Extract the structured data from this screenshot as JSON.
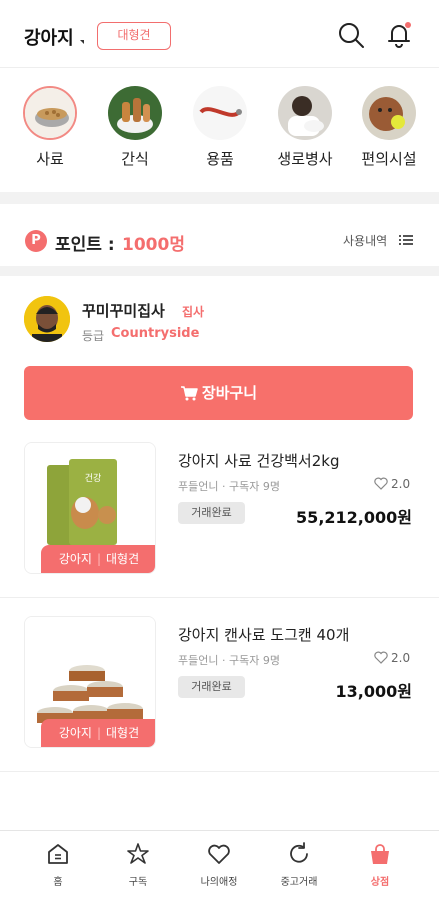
{
  "header": {
    "title": "강아지",
    "size_tag": "대형견",
    "icons": [
      "search-icon",
      "bell-icon"
    ],
    "accent_color": "#f46e6e"
  },
  "categories": [
    {
      "label": "사료",
      "selected": true
    },
    {
      "label": "간식",
      "selected": false
    },
    {
      "label": "용품",
      "selected": false
    },
    {
      "label": "생로병사",
      "selected": false
    },
    {
      "label": "편의시설",
      "selected": false
    }
  ],
  "points": {
    "badge": "P",
    "label": "포인트 :",
    "value": "1000멍",
    "history_label": "사용내역"
  },
  "profile": {
    "nickname": "꾸미꾸미집사",
    "role": "집사",
    "grade_label": "등급",
    "grade_value": "Countryside"
  },
  "cart_button": {
    "label": "장바구니"
  },
  "products": [
    {
      "name": "강아지 사료 건강백서2kg",
      "seller": "푸들언니 · 구독자 9명",
      "likes": "2.0",
      "status": "거래완료",
      "price": "55,212,000원",
      "tag_animal": "강아지",
      "tag_size": "대형견"
    },
    {
      "name": "강아지 캔사료 도그캔 40개",
      "seller": "푸들언니 · 구독자 9명",
      "likes": "2.0",
      "status": "거래완료",
      "price": "13,000원",
      "tag_animal": "강아지",
      "tag_size": "대형견"
    }
  ],
  "bottom_nav": [
    {
      "label": "홈",
      "icon": "home-icon",
      "active": false
    },
    {
      "label": "구독",
      "icon": "subscribe-icon",
      "active": false
    },
    {
      "label": "나의애정",
      "icon": "heart-icon",
      "active": false
    },
    {
      "label": "중고거래",
      "icon": "refresh-icon",
      "active": false
    },
    {
      "label": "상점",
      "icon": "shop-bag-icon",
      "active": true
    }
  ]
}
